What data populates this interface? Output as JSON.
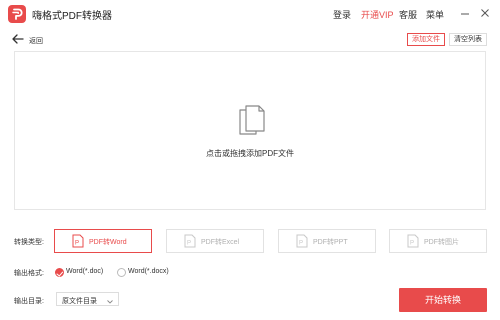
{
  "app": {
    "title": "嗨格式PDF转换器",
    "brand_color": "#e84b4b"
  },
  "topnav": {
    "login": "登录",
    "vip": "开通VIP",
    "service": "客服",
    "menu": "菜单"
  },
  "window_controls": [
    "minimize-icon",
    "close-icon"
  ],
  "toolbar": {
    "back_label": "返回",
    "add_file": "添加文件",
    "clear_list": "清空列表"
  },
  "dropzone": {
    "hint": "点击或拖拽添加PDF文件",
    "icon": "file-stack-icon"
  },
  "conversion": {
    "label": "转换类型:",
    "options": [
      {
        "label": "PDF转Word",
        "active": true
      },
      {
        "label": "PDF转Excel",
        "active": false
      },
      {
        "label": "PDF转PPT",
        "active": false
      },
      {
        "label": "PDF转图片",
        "active": false
      }
    ]
  },
  "output_format": {
    "label": "输出格式:",
    "options": [
      {
        "label": "Word(*.doc)",
        "checked": true
      },
      {
        "label": "Word(*.docx)",
        "checked": false
      }
    ]
  },
  "output_dir": {
    "label": "输出目录:",
    "value": "原文件目录"
  },
  "start_button": "开始转换"
}
